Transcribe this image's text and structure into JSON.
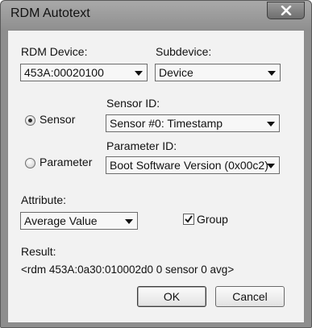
{
  "window": {
    "title": "RDM Autotext"
  },
  "device": {
    "label": "RDM Device:",
    "value": "453A:00020100"
  },
  "subdevice": {
    "label": "Subdevice:",
    "value": "Device"
  },
  "sensor": {
    "radio_label": "Sensor",
    "selected": true,
    "id_label": "Sensor ID:",
    "id_value": "Sensor #0: Timestamp"
  },
  "parameter": {
    "radio_label": "Parameter",
    "selected": false,
    "id_label": "Parameter ID:",
    "id_value": "Boot Software Version (0x00c2)"
  },
  "attribute": {
    "label": "Attribute:",
    "value": "Average Value"
  },
  "group": {
    "label": "Group",
    "checked": true
  },
  "result": {
    "label": "Result:",
    "text": "<rdm 453A:0a30:010002d0 0 sensor 0 avg>"
  },
  "buttons": {
    "ok": "OK",
    "cancel": "Cancel"
  },
  "icons": {
    "close": "close-icon",
    "checkmark": "checkmark-icon",
    "dropdown": "chevron-down-icon"
  }
}
